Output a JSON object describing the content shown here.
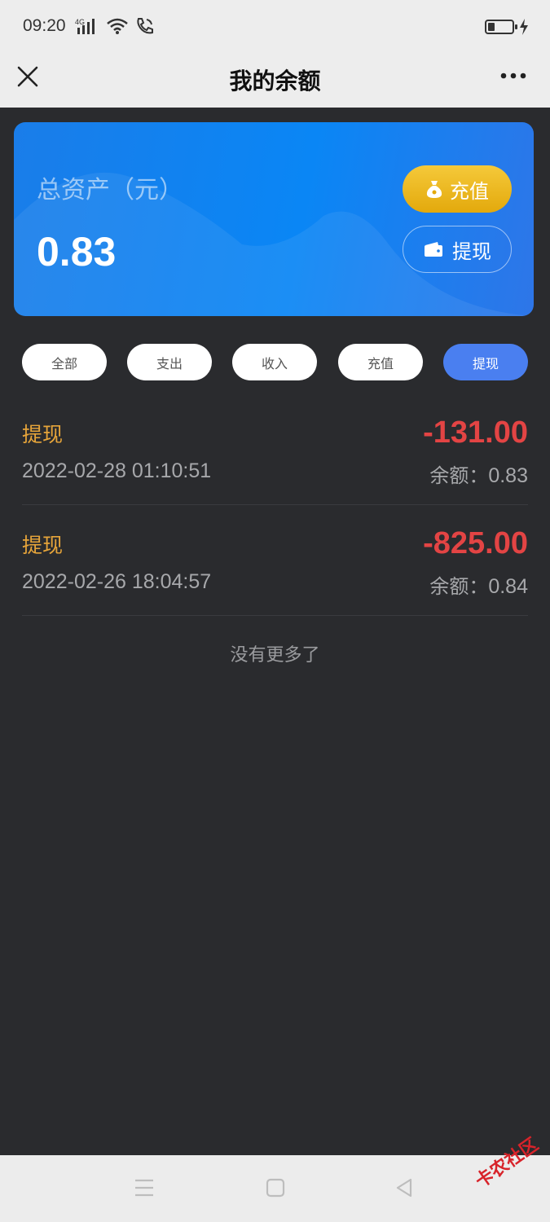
{
  "status_bar": {
    "time": "09:20",
    "network": "4G"
  },
  "nav": {
    "title": "我的余额"
  },
  "asset_card": {
    "label": "总资产（元）",
    "value": "0.83",
    "recharge_label": "充值",
    "withdraw_label": "提现"
  },
  "filters": [
    {
      "label": "全部",
      "active": false
    },
    {
      "label": "支出",
      "active": false
    },
    {
      "label": "收入",
      "active": false
    },
    {
      "label": "充值",
      "active": false
    },
    {
      "label": "提现",
      "active": true
    }
  ],
  "transactions": [
    {
      "type": "提现",
      "date": "2022-02-28 01:10:51",
      "amount": "-131.00",
      "balance_label": "余额：",
      "balance": "0.83"
    },
    {
      "type": "提现",
      "date": "2022-02-26 18:04:57",
      "amount": "-825.00",
      "balance_label": "余额：",
      "balance": "0.84"
    }
  ],
  "end_text": "没有更多了",
  "watermark": "卡农社区",
  "colors": {
    "accent": "#4a7ff0",
    "amount": "#e34444",
    "tx_type": "#e7a53a",
    "recharge": "#e3a90c"
  }
}
